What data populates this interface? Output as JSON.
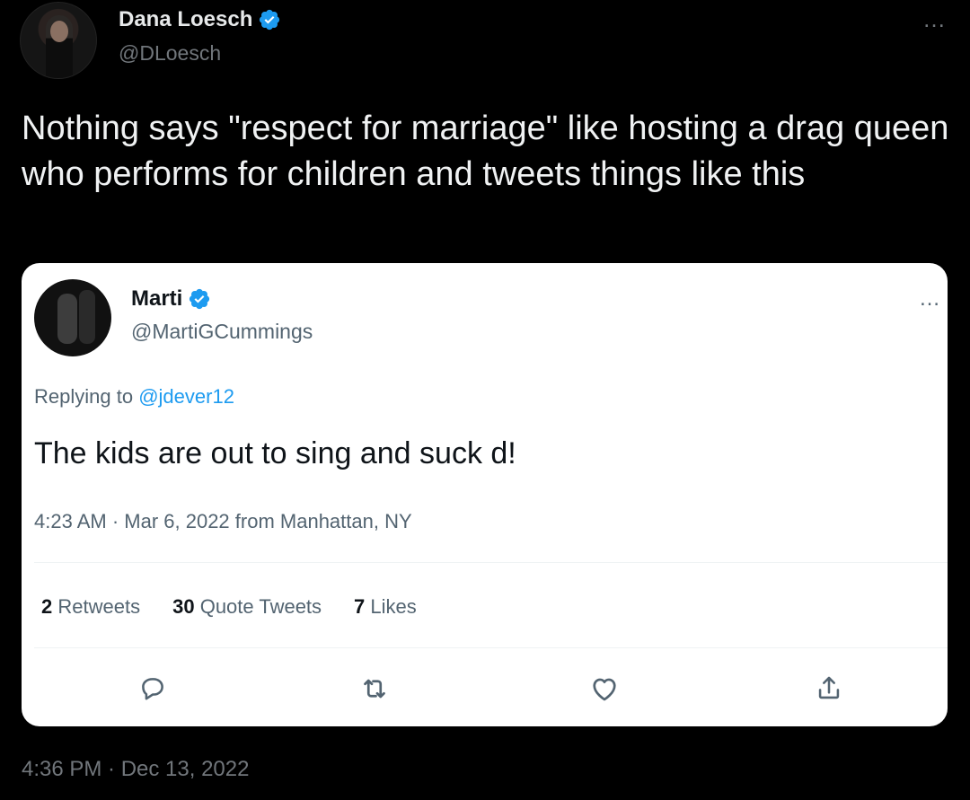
{
  "outer_tweet": {
    "name": "Dana Loesch",
    "handle": "@DLoesch",
    "text": "Nothing says \"respect for marriage\" like hosting a drag queen who performs for children and tweets things like this",
    "timestamp": "4:36 PM · Dec 13, 2022",
    "more_icon": "…"
  },
  "quoted_tweet": {
    "name": "Marti",
    "handle": "@MartiGCummings",
    "replying_prefix": "Replying to",
    "replying_to": "@jdever12",
    "text": "The kids are out to sing and suck d!",
    "meta": "4:23 AM · Mar 6, 2022 from Manhattan, NY",
    "more_icon": "…",
    "stats": {
      "retweets_count": "2",
      "retweets_label": "Retweets",
      "quotes_count": "30",
      "quotes_label": "Quote Tweets",
      "likes_count": "7",
      "likes_label": "Likes"
    }
  },
  "colors": {
    "verified": "#1d9bf0",
    "link": "#1d9bf0",
    "background": "#000000",
    "card": "#ffffff",
    "muted": "#71767b"
  },
  "icons": [
    "verified-badge-icon",
    "more-icon",
    "reply-icon",
    "retweet-icon",
    "like-icon",
    "share-icon"
  ]
}
